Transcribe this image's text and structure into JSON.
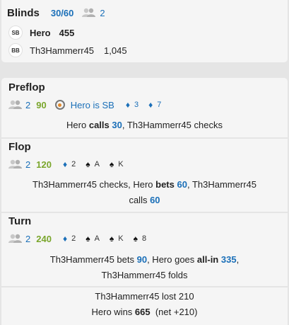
{
  "blinds": {
    "title": "Blinds",
    "amount": "30/60",
    "player_count": "2",
    "players": [
      {
        "position": "SB",
        "name": "Hero",
        "stack": "455"
      },
      {
        "position": "BB",
        "name": "Th3Hammerr45",
        "stack": "1,045"
      }
    ]
  },
  "preflop": {
    "title": "Preflop",
    "player_count": "2",
    "pot": "90",
    "hero_position": "Hero is SB",
    "hole_cards": [
      {
        "suit": "diamond",
        "rank": "3"
      },
      {
        "suit": "diamond",
        "rank": "7"
      }
    ],
    "action": {
      "a": "Hero ",
      "b": "calls",
      "c": " ",
      "d": "30",
      "e": ", Th3Hammerr45 checks"
    }
  },
  "flop": {
    "title": "Flop",
    "player_count": "2",
    "pot": "120",
    "cards": [
      {
        "suit": "diamond",
        "rank": "2"
      },
      {
        "suit": "spade",
        "rank": "A"
      },
      {
        "suit": "spade",
        "rank": "K"
      }
    ],
    "action": {
      "a": "Th3Hammerr45 checks, Hero ",
      "b": "bets",
      "c": " ",
      "d": "60",
      "e": ", Th3Hammerr45",
      "f": "calls ",
      "g": "60"
    }
  },
  "turn": {
    "title": "Turn",
    "player_count": "2",
    "pot": "240",
    "cards": [
      {
        "suit": "diamond",
        "rank": "2"
      },
      {
        "suit": "spade",
        "rank": "A"
      },
      {
        "suit": "spade",
        "rank": "K"
      },
      {
        "suit": "spade",
        "rank": "8"
      }
    ],
    "action": {
      "a": "Th3Hammerr45 bets ",
      "b": "90",
      "c": ", Hero goes ",
      "d": "all-in",
      "e": " ",
      "f": "335",
      "g": ",",
      "h": "Th3Hammerr45 folds"
    }
  },
  "result": {
    "line1": "Th3Hammerr45 lost 210",
    "line2_a": "Hero wins ",
    "line2_b": "665",
    "line2_c": "  (net +210)"
  },
  "colors": {
    "accent_blue": "#1a6fb8",
    "pot_green": "#7aa62c",
    "background": "#e5e5e5",
    "card": "#f5f5f5"
  }
}
